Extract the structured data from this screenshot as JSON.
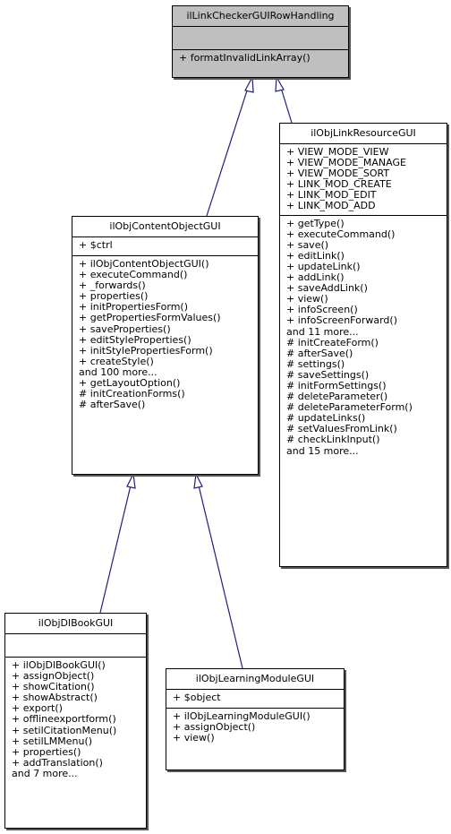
{
  "diagram": {
    "edge_color": "#1f1f7a",
    "classes": {
      "row_handling": {
        "name": "ilLinkCheckerGUIRowHandling",
        "attributes": [],
        "methods": [
          "+ formatInvalidLinkArray()"
        ]
      },
      "link_resource": {
        "name": "ilObjLinkResourceGUI",
        "attributes": [
          "+ VIEW_MODE_VIEW",
          "+ VIEW_MODE_MANAGE",
          "+ VIEW_MODE_SORT",
          "+ LINK_MOD_CREATE",
          "+ LINK_MOD_EDIT",
          "+ LINK_MOD_ADD"
        ],
        "methods": [
          "+ getType()",
          "+ executeCommand()",
          "+ save()",
          "+ editLink()",
          "+ updateLink()",
          "+ addLink()",
          "+ saveAddLink()",
          "+ view()",
          "+ infoScreen()",
          "+ infoScreenForward()",
          "and 11 more...",
          "# initCreateForm()",
          "# afterSave()",
          "# settings()",
          "# saveSettings()",
          "# initFormSettings()",
          "# deleteParameter()",
          "# deleteParameterForm()",
          "# updateLinks()",
          "# setValuesFromLink()",
          "# checkLinkInput()",
          "and 15 more..."
        ]
      },
      "content_object": {
        "name": "ilObjContentObjectGUI",
        "attributes": [
          "+ $ctrl"
        ],
        "methods": [
          "+ ilObjContentObjectGUI()",
          "+ executeCommand()",
          "+ _forwards()",
          "+ properties()",
          "+ initPropertiesForm()",
          "+ getPropertiesFormValues()",
          "+ saveProperties()",
          "+ editStyleProperties()",
          "+ initStylePropertiesForm()",
          "+ createStyle()",
          "and 100 more...",
          "+ getLayoutOption()",
          "# initCreationForms()",
          "# afterSave()"
        ]
      },
      "dl_book": {
        "name": "ilObjDlBookGUI",
        "attributes": [],
        "methods": [
          "+ ilObjDlBookGUI()",
          "+ assignObject()",
          "+ showCitation()",
          "+ showAbstract()",
          "+ export()",
          "+ offlineexportform()",
          "+ setilCitationMenu()",
          "+ setilLMMenu()",
          "+ properties()",
          "+ addTranslation()",
          "and 7 more..."
        ]
      },
      "learning_module": {
        "name": "ilObjLearningModuleGUI",
        "attributes": [
          "+ $object"
        ],
        "methods": [
          "+ ilObjLearningModuleGUI()",
          "+ assignObject()",
          "+ view()"
        ]
      }
    },
    "inheritance": [
      {
        "child": "ilObjContentObjectGUI",
        "parent": "ilLinkCheckerGUIRowHandling"
      },
      {
        "child": "ilObjLinkResourceGUI",
        "parent": "ilLinkCheckerGUIRowHandling"
      },
      {
        "child": "ilObjDlBookGUI",
        "parent": "ilObjContentObjectGUI"
      },
      {
        "child": "ilObjLearningModuleGUI",
        "parent": "ilObjContentObjectGUI"
      }
    ]
  }
}
